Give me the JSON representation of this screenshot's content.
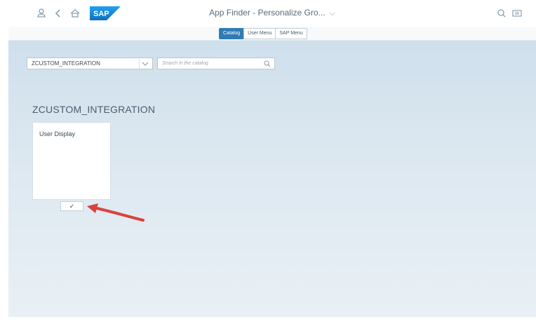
{
  "shell": {
    "title": "App Finder - Personalize Gro...",
    "title_chevron": "⌵",
    "logo_text": "SAP",
    "icons": [
      "user-icon",
      "back-icon",
      "home-icon",
      "search-icon",
      "notifications-icon"
    ]
  },
  "tabs": [
    {
      "label": "Catalog",
      "active": true
    },
    {
      "label": "User Menu",
      "active": false
    },
    {
      "label": "SAP Menu",
      "active": false
    }
  ],
  "catalog_select": {
    "value": "ZCUSTOM_INTEGRATION"
  },
  "search": {
    "placeholder": "Search in the catalog"
  },
  "group": {
    "heading": "ZCUSTOM_INTEGRATION",
    "tiles": [
      {
        "title": "User Display",
        "checked": true,
        "check_glyph": "✓"
      }
    ]
  },
  "colors": {
    "accent": "#2f7bb4",
    "annotation_arrow": "#d9423d",
    "sap_blue": "#1a8ae0"
  }
}
